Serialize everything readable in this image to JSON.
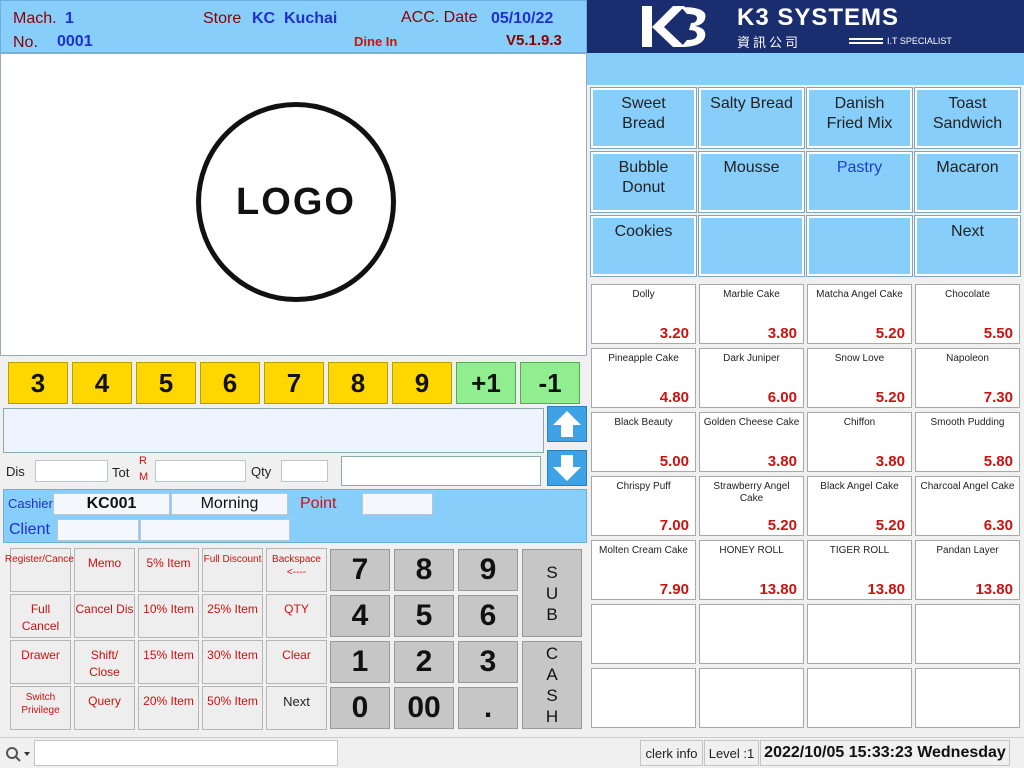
{
  "header": {
    "mach_label": "Mach.",
    "mach_value": "1",
    "no_label": "No.",
    "no_value": "0001",
    "store_label": "Store",
    "store_value": "KC  Kuchai",
    "acc_date_label": "ACC. Date",
    "acc_date_value": "05/10/22",
    "mode": "Dine In",
    "version": "V5.1.9.3"
  },
  "brand": {
    "name": "K3 SYSTEMS",
    "chinese": "資訊公司",
    "tagline": "I.T SPECIALIST",
    "mark": "K3"
  },
  "logo": {
    "text": "LOGO"
  },
  "number_buttons": [
    "3",
    "4",
    "5",
    "6",
    "7",
    "8",
    "9",
    "+1",
    "-1"
  ],
  "fields": {
    "dis_label": "Dis",
    "tot_label": "Tot",
    "rm_label_r": "R",
    "rm_label_m": "M",
    "qty_label": "Qty"
  },
  "cashier": {
    "cashier_label": "Cashier",
    "cashier_id": "KC001",
    "shift": "Morning",
    "point_label": "Point",
    "client_label": "Client"
  },
  "function_buttons": [
    [
      "Register/Cancel",
      "Memo",
      "5% Item",
      "Full Discount",
      "Backspace <----"
    ],
    [
      "Full Cancel",
      "Cancel Dis",
      "10% Item",
      "25% Item",
      "QTY"
    ],
    [
      "Drawer",
      "Shift/ Close",
      "15% Item",
      "30% Item",
      "Clear"
    ],
    [
      "Switch Privilege",
      "Query",
      "20% Item",
      "50% Item",
      "Next"
    ]
  ],
  "keypad": [
    "7",
    "8",
    "9",
    "4",
    "5",
    "6",
    "1",
    "2",
    "3",
    "0",
    "00",
    "."
  ],
  "sub_button": [
    "S",
    "U",
    "B"
  ],
  "cash_button": [
    "C",
    "A",
    "S",
    "H"
  ],
  "categories": [
    "Sweet\nBread",
    "Salty Bread",
    "Danish\nFried  Mix",
    "Toast\nSandwich",
    "Bubble\nDonut",
    "Mousse",
    "Pastry",
    "Macaron",
    "Cookies",
    "",
    "",
    "Next"
  ],
  "products": [
    {
      "name": "Dolly",
      "price": "3.20"
    },
    {
      "name": "Marble Cake",
      "price": "3.80"
    },
    {
      "name": "Matcha Angel Cake",
      "price": "5.20"
    },
    {
      "name": "Chocolate",
      "price": "5.50"
    },
    {
      "name": "Pineapple Cake",
      "price": "4.80"
    },
    {
      "name": "Dark Juniper",
      "price": "6.00"
    },
    {
      "name": "Snow Love",
      "price": "5.20"
    },
    {
      "name": "Napoleon",
      "price": "7.30"
    },
    {
      "name": "Black Beauty",
      "price": "5.00"
    },
    {
      "name": "Golden Cheese Cake",
      "price": "3.80"
    },
    {
      "name": "Chiffon",
      "price": "3.80"
    },
    {
      "name": "Smooth Pudding",
      "price": "5.80"
    },
    {
      "name": "Chrispy Puff",
      "price": "7.00"
    },
    {
      "name": "Strawberry Angel Cake",
      "price": "5.20"
    },
    {
      "name": "Black Angel Cake",
      "price": "5.20"
    },
    {
      "name": "Charcoal Angel Cake",
      "price": "6.30"
    },
    {
      "name": "Molten Cream Cake",
      "price": "7.90"
    },
    {
      "name": "HONEY ROLL",
      "price": "13.80"
    },
    {
      "name": "TIGER ROLL",
      "price": "13.80"
    },
    {
      "name": "Pandan Layer",
      "price": "13.80"
    },
    {
      "name": "",
      "price": ""
    },
    {
      "name": "",
      "price": ""
    },
    {
      "name": "",
      "price": ""
    },
    {
      "name": "",
      "price": ""
    },
    {
      "name": "",
      "price": ""
    },
    {
      "name": "",
      "price": ""
    },
    {
      "name": "",
      "price": ""
    },
    {
      "name": "",
      "price": ""
    }
  ],
  "status": {
    "clerk_info": "clerk info",
    "level": "Level :1",
    "datetime": "2022/10/05 15:33:23 Wednesday"
  },
  "colors": {
    "header_bg": "#87cefa",
    "brand_bg": "#1a2d6e",
    "number_yellow": "#ffd700",
    "number_green": "#90ee90",
    "price_red": "#cc1111",
    "arrow_blue": "#3da3e6"
  }
}
